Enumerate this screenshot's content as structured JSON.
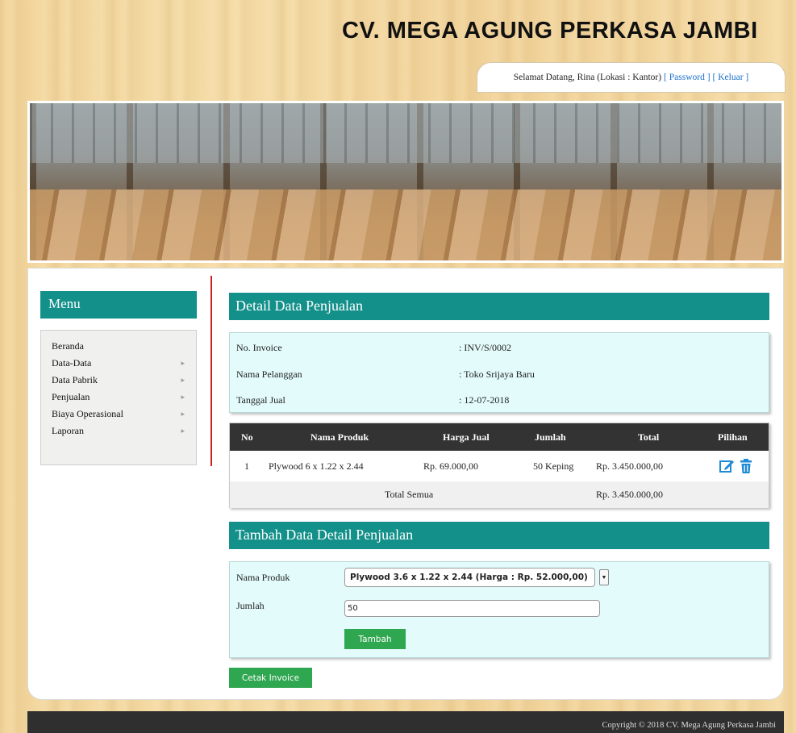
{
  "header": {
    "site_title": "CV. MEGA AGUNG PERKASA JAMBI",
    "welcome_text": "Selamat Datang, Rina (Lokasi : Kantor)",
    "password_link": "[ Password ]",
    "logout_link": "[ Keluar ]"
  },
  "sidebar": {
    "title": "Menu",
    "items": [
      {
        "label": "Beranda",
        "has_submenu": false
      },
      {
        "label": "Data-Data",
        "has_submenu": true
      },
      {
        "label": "Data Pabrik",
        "has_submenu": true
      },
      {
        "label": "Penjualan",
        "has_submenu": true
      },
      {
        "label": "Biaya Operasional",
        "has_submenu": true
      },
      {
        "label": "Laporan",
        "has_submenu": true
      }
    ],
    "submenu_glyph": "▸"
  },
  "detail": {
    "title": "Detail Data Penjualan",
    "rows": [
      {
        "label": "No. Invoice",
        "value": ": INV/S/0002"
      },
      {
        "label": "Nama Pelanggan",
        "value": ": Toko Srijaya Baru"
      },
      {
        "label": "Tanggal Jual",
        "value": ": 12-07-2018"
      }
    ]
  },
  "table": {
    "headers": [
      "No",
      "Nama Produk",
      "Harga Jual",
      "Jumlah",
      "Total",
      "Pilihan"
    ],
    "rows": [
      {
        "no": "1",
        "product": "Plywood 6 x 1.22 x 2.44",
        "price": "Rp. 69.000,00",
        "qty": "50 Keping",
        "total": "Rp. 3.450.000,00"
      }
    ],
    "total_label": "Total Semua",
    "total_value": "Rp. 3.450.000,00"
  },
  "add_form": {
    "title": "Tambah Data Detail Penjualan",
    "product_label": "Nama Produk",
    "product_selected": "Plywood 3.6 x 1.22 x 2.44 (Harga : Rp. 52.000,00)",
    "qty_label": "Jumlah",
    "qty_value": "50",
    "submit_label": "Tambah"
  },
  "print_button_label": "Cetak Invoice",
  "footer_text": "Copyright © 2018 CV. Mega Agung Perkasa Jambi",
  "colors": {
    "accent": "#13908a",
    "button_green": "#2fa650",
    "link_blue": "#1a6fc9",
    "divider_red": "#d11f1f",
    "table_header": "#333333",
    "form_bg": "#e3fbfb"
  },
  "icons": [
    "edit-icon",
    "delete-icon",
    "dropdown-arrow-icon",
    "submenu-arrow-icon"
  ]
}
